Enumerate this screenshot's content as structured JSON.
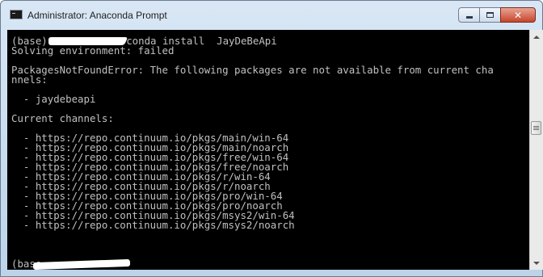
{
  "window": {
    "title": "Administrator: Anaconda Prompt",
    "icon": "console-window-icon",
    "controls": {
      "minimize_icon": "minimize-icon",
      "maximize_icon": "maximize-icon",
      "close_glyph": "✕"
    }
  },
  "console": {
    "prompt_prefix": "(base) ",
    "command_partial": "conda install  JayDeBeApi",
    "prompt_prefix_final": "(base",
    "lines": [
      "Solving environment: failed",
      "",
      "PackagesNotFoundError: The following packages are not available from current cha",
      "nnels:",
      "",
      "  - jaydebeapi",
      "",
      "Current channels:",
      "",
      "  - https://repo.continuum.io/pkgs/main/win-64",
      "  - https://repo.continuum.io/pkgs/main/noarch",
      "  - https://repo.continuum.io/pkgs/free/win-64",
      "  - https://repo.continuum.io/pkgs/free/noarch",
      "  - https://repo.continuum.io/pkgs/r/win-64",
      "  - https://repo.continuum.io/pkgs/r/noarch",
      "  - https://repo.continuum.io/pkgs/pro/win-64",
      "  - https://repo.continuum.io/pkgs/pro/noarch",
      "  - https://repo.continuum.io/pkgs/msys2/win-64",
      "  - https://repo.continuum.io/pkgs/msys2/noarch"
    ]
  },
  "colors": {
    "console_bg": "#000000",
    "console_fg": "#c0c0c0",
    "close_button": "#c7442c"
  }
}
